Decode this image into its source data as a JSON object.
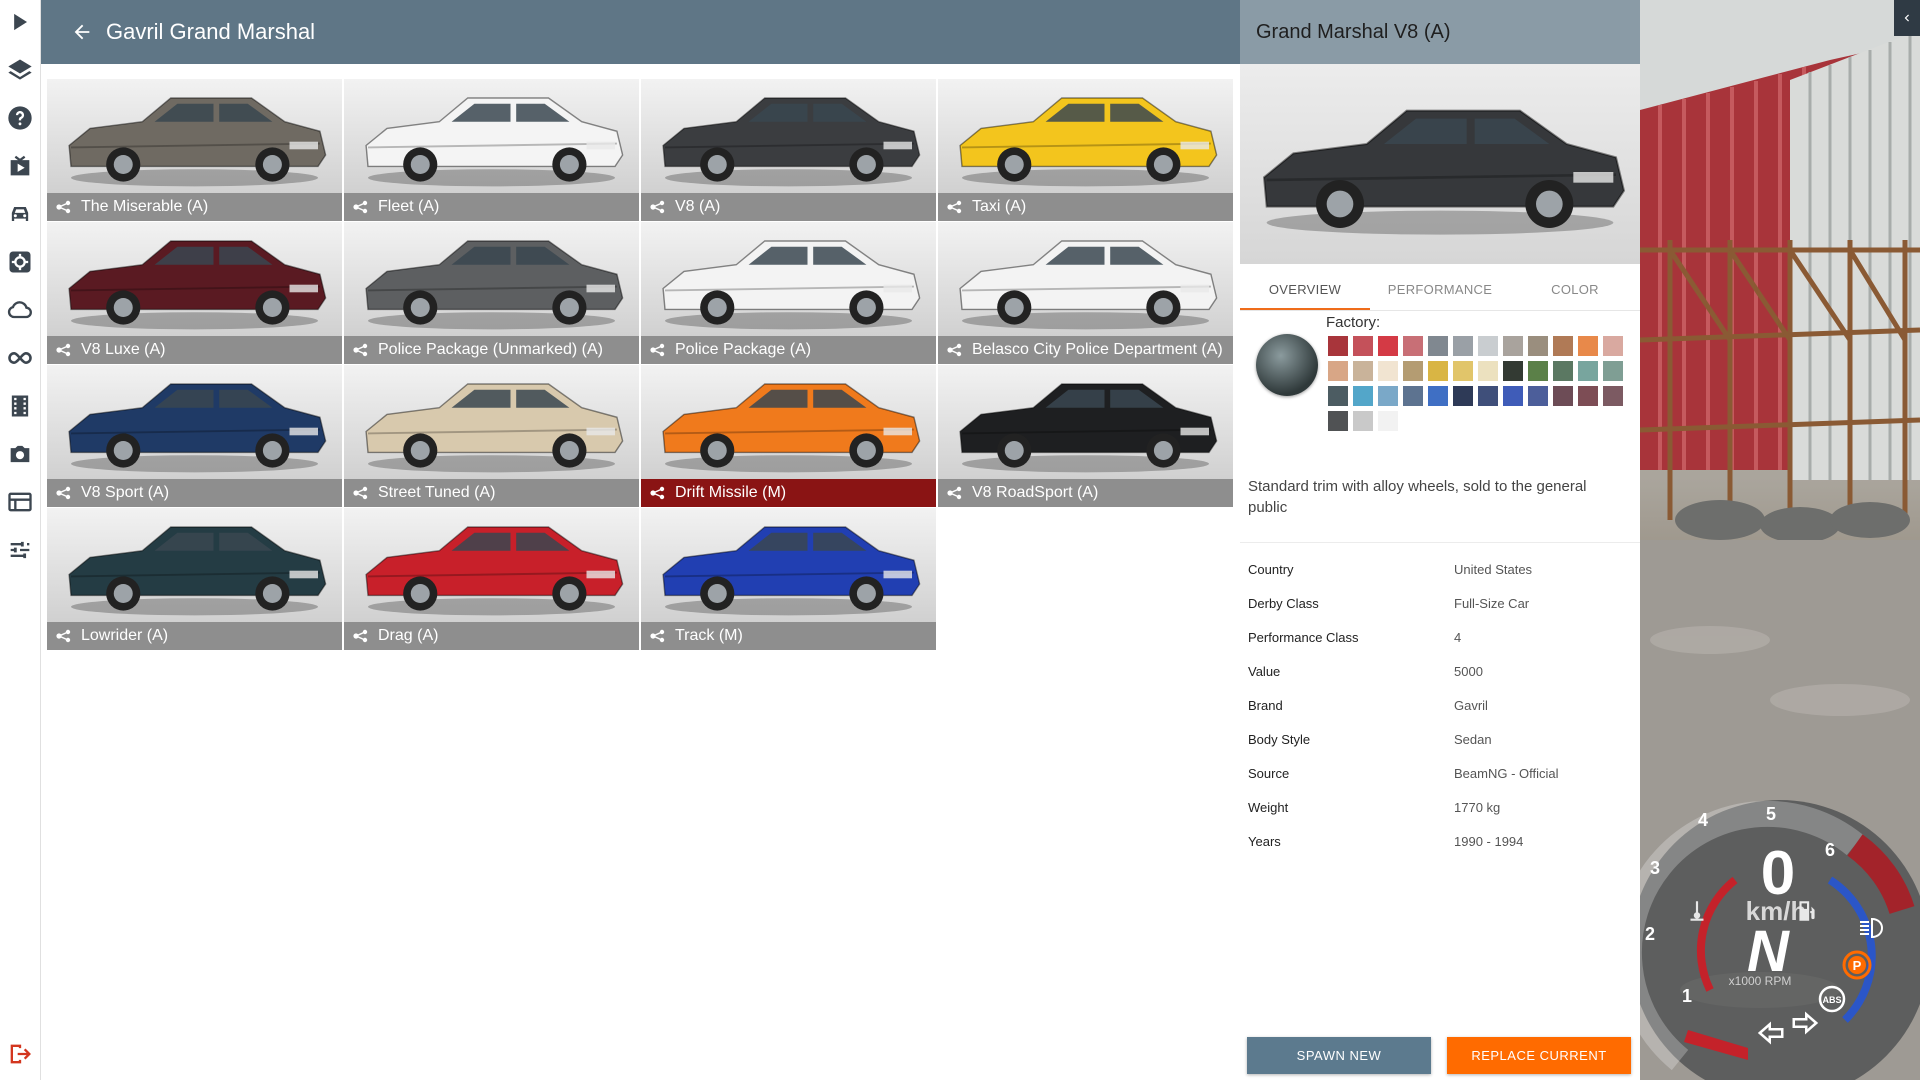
{
  "header": {
    "title": "Gavril Grand Marshal"
  },
  "rail": {
    "top": [
      "play-icon",
      "layers-icon",
      "help-icon",
      "scenario-icon",
      "car-icon",
      "settings-icon",
      "cloud-icon",
      "infinity-icon",
      "film-icon",
      "camera-icon",
      "dashboard-icon",
      "sliders-icon"
    ],
    "bottom": [
      "exit-icon"
    ]
  },
  "configs": [
    {
      "label": "The Miserable (A)",
      "color": "#6f6a62"
    },
    {
      "label": "Fleet (A)",
      "color": "#f4f4f4"
    },
    {
      "label": "V8 (A)",
      "color": "#3b3d40"
    },
    {
      "label": "Taxi (A)",
      "color": "#f3c51d"
    },
    {
      "label": "V8 Luxe (A)",
      "color": "#5a1a22"
    },
    {
      "label": "Police Package (Unmarked) (A)",
      "color": "#5d5f61"
    },
    {
      "label": "Police Package (A)",
      "color": "#f3f3f3"
    },
    {
      "label": "Belasco City Police Department (A)",
      "color": "#f3f3f3"
    },
    {
      "label": "V8 Sport (A)",
      "color": "#1f3a66"
    },
    {
      "label": "Street Tuned (A)",
      "color": "#d8c9ad"
    },
    {
      "label": "Drift Missile (M)",
      "color": "#f07a1c"
    },
    {
      "label": "V8 RoadSport (A)",
      "color": "#1e1f21"
    },
    {
      "label": "Lowrider (A)",
      "color": "#243c44"
    },
    {
      "label": "Drag (A)",
      "color": "#c8202a"
    },
    {
      "label": "Track (M)",
      "color": "#213fb2"
    }
  ],
  "selected_index": 10,
  "detail": {
    "title": "Grand Marshal V8 (A)",
    "preview_color": "#36383b",
    "tabs": [
      "OVERVIEW",
      "PERFORMANCE",
      "COLOR"
    ],
    "active_tab": 0,
    "factory_label": "Factory:",
    "swatch_colors": [
      "#a8353b",
      "#c4515a",
      "#d43a45",
      "#c86f76",
      "#808890",
      "#9aa0a6",
      "#c9cdd0",
      "#a9a39d",
      "#9a8e7e",
      "#b07a56",
      "#e8894a",
      "#d9a9a0",
      "#d8a686",
      "#c9b39a",
      "#f1e4d1",
      "#b49c72",
      "#d9b544",
      "#e1c56a",
      "#ece1bf",
      "#333a33",
      "#5b8048",
      "#5b7862",
      "#78a59e",
      "#7f9e94",
      "#4c5c62",
      "#53a6c9",
      "#7aa8c8",
      "#5d7390",
      "#3f6fc4",
      "#2e3a57",
      "#3f4f7a",
      "#3f5cb8",
      "#4c5e9a",
      "#6d4c56",
      "#7d4d55",
      "#7c5a62",
      "#505254",
      "#c9c9c9",
      "#f2f2f2"
    ],
    "description": "Standard trim with alloy wheels, sold to the general public",
    "info": [
      {
        "key": "Country",
        "value": "United States"
      },
      {
        "key": "Derby Class",
        "value": "Full-Size Car"
      },
      {
        "key": "Performance Class",
        "value": "4"
      },
      {
        "key": "Value",
        "value": "5000"
      },
      {
        "key": "Brand",
        "value": "Gavril"
      },
      {
        "key": "Body Style",
        "value": "Sedan"
      },
      {
        "key": "Source",
        "value": "BeamNG - Official"
      },
      {
        "key": "Weight",
        "value": "1770 kg"
      },
      {
        "key": "Years",
        "value": "1990 - 1994"
      }
    ],
    "buttons": {
      "spawn": "SPAWN NEW",
      "replace": "REPLACE CURRENT"
    },
    "accent": "#ff6b00"
  },
  "hud": {
    "speed": "0",
    "speed_unit": "km/h",
    "gear": "N",
    "rpm_unit": "x1000 RPM",
    "rpm_ticks": [
      "1",
      "2",
      "3",
      "4",
      "5",
      "6"
    ],
    "indicators": [
      "headlight-icon",
      "parking-brake-icon",
      "abs-icon",
      "turn-left-icon",
      "turn-right-icon",
      "fuel-icon",
      "temperature-icon"
    ]
  }
}
